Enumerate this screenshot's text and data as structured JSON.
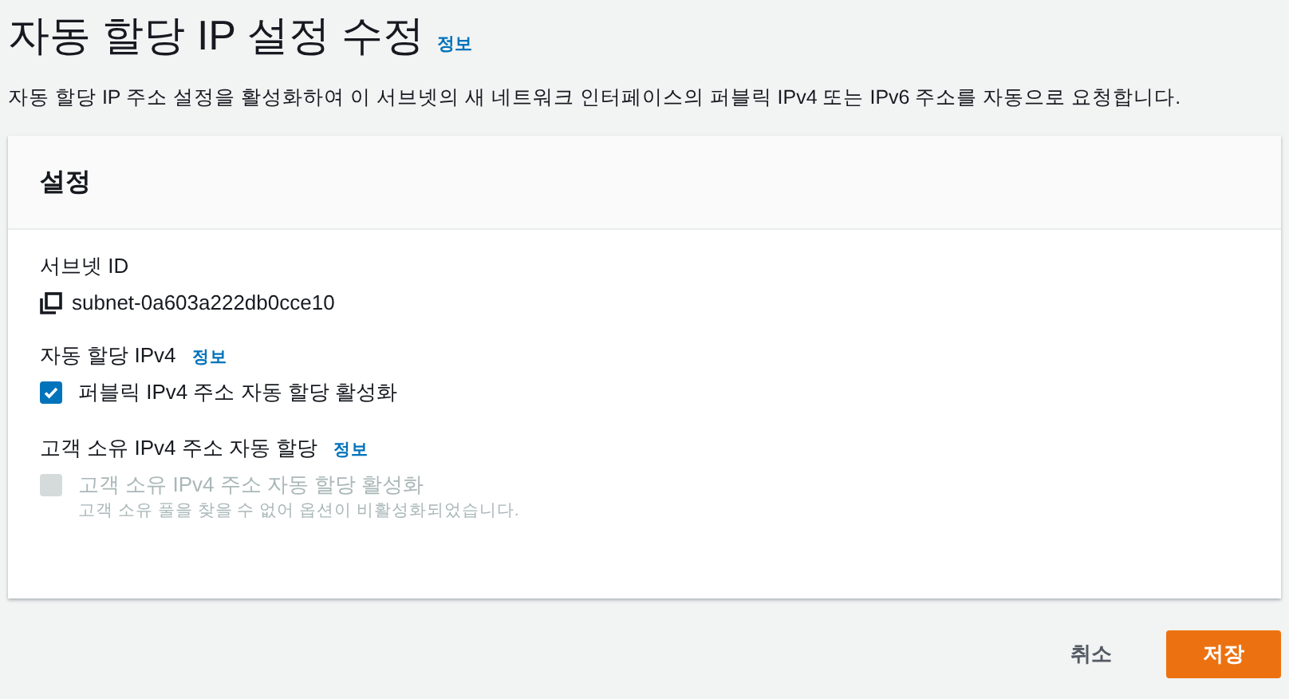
{
  "page": {
    "title": "자동 할당 IP 설정 수정",
    "info_link": "정보",
    "description": "자동 할당 IP 주소 설정을 활성화하여 이 서브넷의 새 네트워크 인터페이스의 퍼블릭 IPv4 또는 IPv6 주소를 자동으로 요청합니다."
  },
  "panel": {
    "title": "설정",
    "fields": [
      {
        "kind": "copy",
        "label": "서브넷 ID",
        "value": "subnet-0a603a222db0cce10"
      },
      {
        "kind": "checkbox",
        "label": "자동 할당 IPv4",
        "info_link": "정보",
        "option": "퍼블릭 IPv4 주소 자동 할당 활성화",
        "checked": true,
        "disabled": false
      },
      {
        "kind": "checkbox",
        "label": "고객 소유 IPv4 주소 자동 할당",
        "info_link": "정보",
        "option": "고객 소유 IPv4 주소 자동 할당 활성화",
        "checked": false,
        "disabled": true,
        "hint": "고객 소유 풀을 찾을 수 없어 옵션이 비활성화되었습니다."
      }
    ]
  },
  "buttons": [
    {
      "kind": "link",
      "label": "취소"
    },
    {
      "kind": "primary",
      "label": "저장"
    }
  ]
}
